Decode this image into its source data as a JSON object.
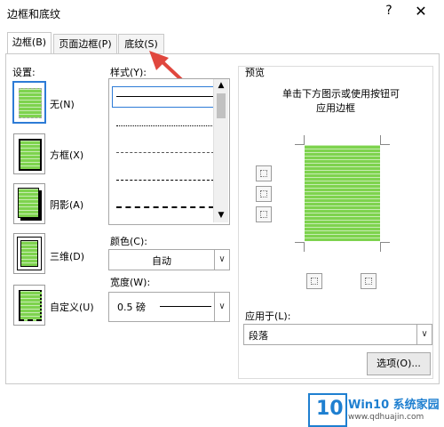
{
  "window": {
    "title": "边框和底纹",
    "help": "?",
    "close": "✕"
  },
  "tabs": [
    {
      "label": "边框(B)",
      "active": true
    },
    {
      "label": "页面边框(P)",
      "active": false
    },
    {
      "label": "底纹(S)",
      "active": false
    }
  ],
  "settings": {
    "header": "设置:",
    "items": [
      {
        "label": "无(N)",
        "icon": "none-border-icon"
      },
      {
        "label": "方框(X)",
        "icon": "box-border-icon"
      },
      {
        "label": "阴影(A)",
        "icon": "shadow-border-icon"
      },
      {
        "label": "三维(D)",
        "icon": "3d-border-icon"
      },
      {
        "label": "自定义(U)",
        "icon": "custom-border-icon"
      }
    ]
  },
  "style": {
    "header": "样式(Y):"
  },
  "color": {
    "label": "颜色(C):",
    "value": "自动"
  },
  "width": {
    "label": "宽度(W):",
    "value": "0.5 磅"
  },
  "preview": {
    "header": "预览",
    "hint_line1": "单击下方图示或使用按钮可",
    "hint_line2": "应用边框"
  },
  "apply_to": {
    "label": "应用于(L):",
    "value": "段落"
  },
  "options_button": "选项(O)...",
  "watermark": {
    "badge": "10",
    "brand": "Win10 系统家园",
    "url": "www.qdhuajin.com"
  },
  "colors": {
    "accent": "#2d7bd6",
    "green": "#7ed34e",
    "arrow": "#e0473e"
  }
}
